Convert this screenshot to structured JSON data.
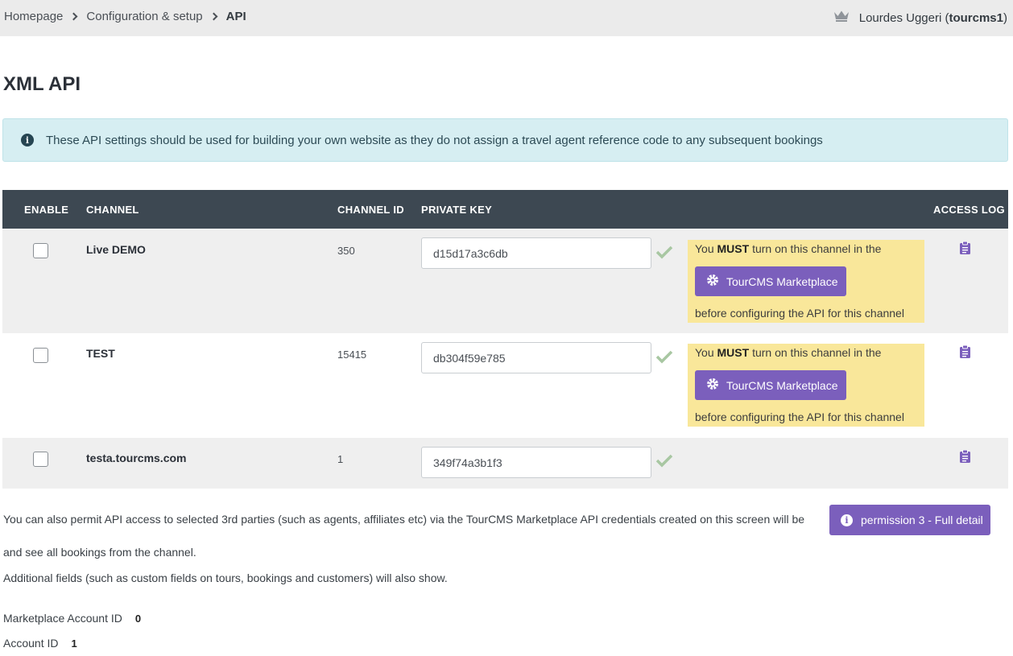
{
  "breadcrumb": {
    "items": [
      "Homepage",
      "Configuration & setup"
    ],
    "current": "API"
  },
  "user": {
    "name": "Lourdes Uggeri (",
    "account": "tourcms1",
    "close": ")"
  },
  "page": {
    "title": "XML API"
  },
  "alert": {
    "text": "These API settings should be used for building your own website as they do not assign a travel agent reference code to any subsequent bookings"
  },
  "table": {
    "headers": {
      "enable": "ENABLE",
      "channel": "CHANNEL",
      "channel_id": "CHANNEL ID",
      "private_key": "PRIVATE KEY",
      "access_log": "ACCESS LOG"
    },
    "rows": [
      {
        "channel": "Live DEMO",
        "channel_id": "350",
        "private_key": "d15d17a3c6db",
        "enabled": false,
        "notice": true
      },
      {
        "channel": "TEST",
        "channel_id": "15415",
        "private_key": "db304f59e785",
        "enabled": false,
        "notice": true
      },
      {
        "channel": "testa.tourcms.com",
        "channel_id": "1",
        "private_key": "349f74a3b1f3",
        "enabled": false,
        "notice": false
      }
    ],
    "notice": {
      "prefix": "You ",
      "must": "MUST",
      "suffix": " turn on this channel in the",
      "button": "TourCMS Marketplace",
      "after": "before configuring the API for this channel"
    }
  },
  "footer": {
    "para1": "You can also permit API access to selected 3rd parties (such as agents, affiliates etc) via the TourCMS Marketplace API credentials created on this screen will be",
    "permission_button": "permission 3 - Full detail",
    "para2": "and see all bookings from the channel.",
    "para3": "Additional fields (such as custom fields on tours, bookings and customers) will also show.",
    "marketplace_label": "Marketplace Account ID",
    "marketplace_value": "0",
    "account_label": "Account ID",
    "account_value": "1"
  },
  "colors": {
    "header_bg": "#3d4852",
    "accent": "#7b5fbc",
    "warning_bg": "#f9e79a",
    "alert_bg": "#d6eef2",
    "check": "#a8c7a2"
  },
  "icons": [
    "chevron-right-icon",
    "crown-icon",
    "info-icon",
    "check-icon",
    "gear-icon",
    "clipboard-icon"
  ]
}
